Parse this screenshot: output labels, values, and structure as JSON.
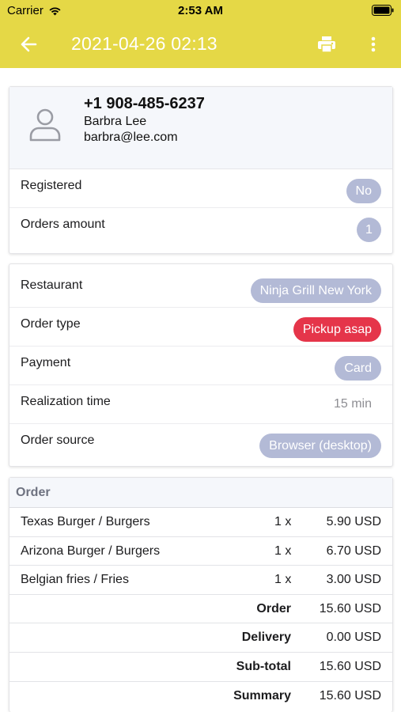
{
  "status_bar": {
    "carrier": "Carrier",
    "time": "2:53 AM"
  },
  "app_bar": {
    "title": "2021-04-26 02:13"
  },
  "customer": {
    "phone": "+1 908-485-6237",
    "name": "Barbra Lee",
    "email": "barbra@lee.com",
    "rows": [
      {
        "label": "Registered",
        "value": "No"
      },
      {
        "label": "Orders amount",
        "value": "1"
      }
    ]
  },
  "details": {
    "rows": [
      {
        "label": "Restaurant",
        "value": "Ninja Grill New York"
      },
      {
        "label": "Order type",
        "value": "Pickup asap"
      },
      {
        "label": "Payment",
        "value": "Card"
      },
      {
        "label": "Realization time",
        "value": "15 min"
      },
      {
        "label": "Order source",
        "value": "Browser (desktop)"
      }
    ]
  },
  "order": {
    "title": "Order",
    "items": [
      {
        "name": "Texas Burger / Burgers",
        "qty": "1 x",
        "amount": "5.90 USD"
      },
      {
        "name": "Arizona Burger / Burgers",
        "qty": "1 x",
        "amount": "6.70 USD"
      },
      {
        "name": "Belgian fries / Fries",
        "qty": "1 x",
        "amount": "3.00 USD"
      }
    ],
    "totals": [
      {
        "label": "Order",
        "amount": "15.60 USD"
      },
      {
        "label": "Delivery",
        "amount": "0.00 USD"
      },
      {
        "label": "Sub-total",
        "amount": "15.60 USD"
      },
      {
        "label": "Summary",
        "amount": "15.60 USD"
      }
    ]
  },
  "colors": {
    "accent": "#e5d846",
    "badge": "#b3bad6",
    "badge_alert": "#e5354a"
  },
  "icons": {
    "back": "arrow-left-icon",
    "print": "printer-icon",
    "more": "more-vertical-icon",
    "avatar": "person-icon",
    "wifi": "wifi-icon",
    "battery": "battery-icon"
  }
}
